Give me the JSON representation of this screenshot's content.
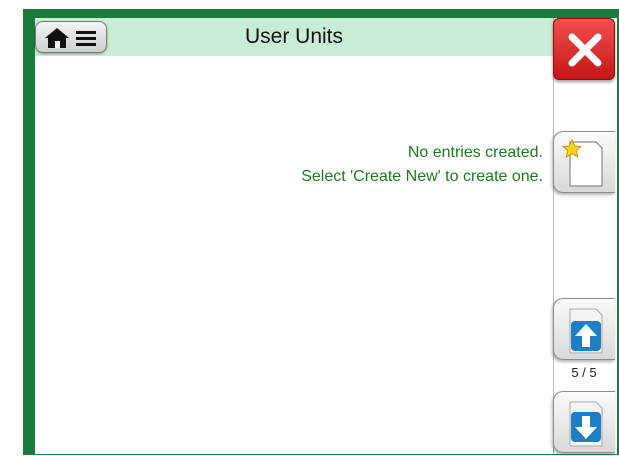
{
  "header": {
    "title": "User Units",
    "home_menu_icon": "home-menu-icon",
    "close_icon": "close-icon"
  },
  "main": {
    "message_line1": "No entries created.",
    "message_line2": "Select 'Create New' to create one."
  },
  "sidebar": {
    "create_new_icon": "new-document-star-icon",
    "page_up_icon": "arrow-up-icon",
    "page_down_icon": "arrow-down-icon",
    "page_indicator": "5 / 5"
  },
  "colors": {
    "frame": "#1b7a3a",
    "titlebar": "#c8ecd4",
    "message_text": "#1f7a1f",
    "close_button": "#d92525",
    "arrow_blue": "#1f7fc4"
  }
}
